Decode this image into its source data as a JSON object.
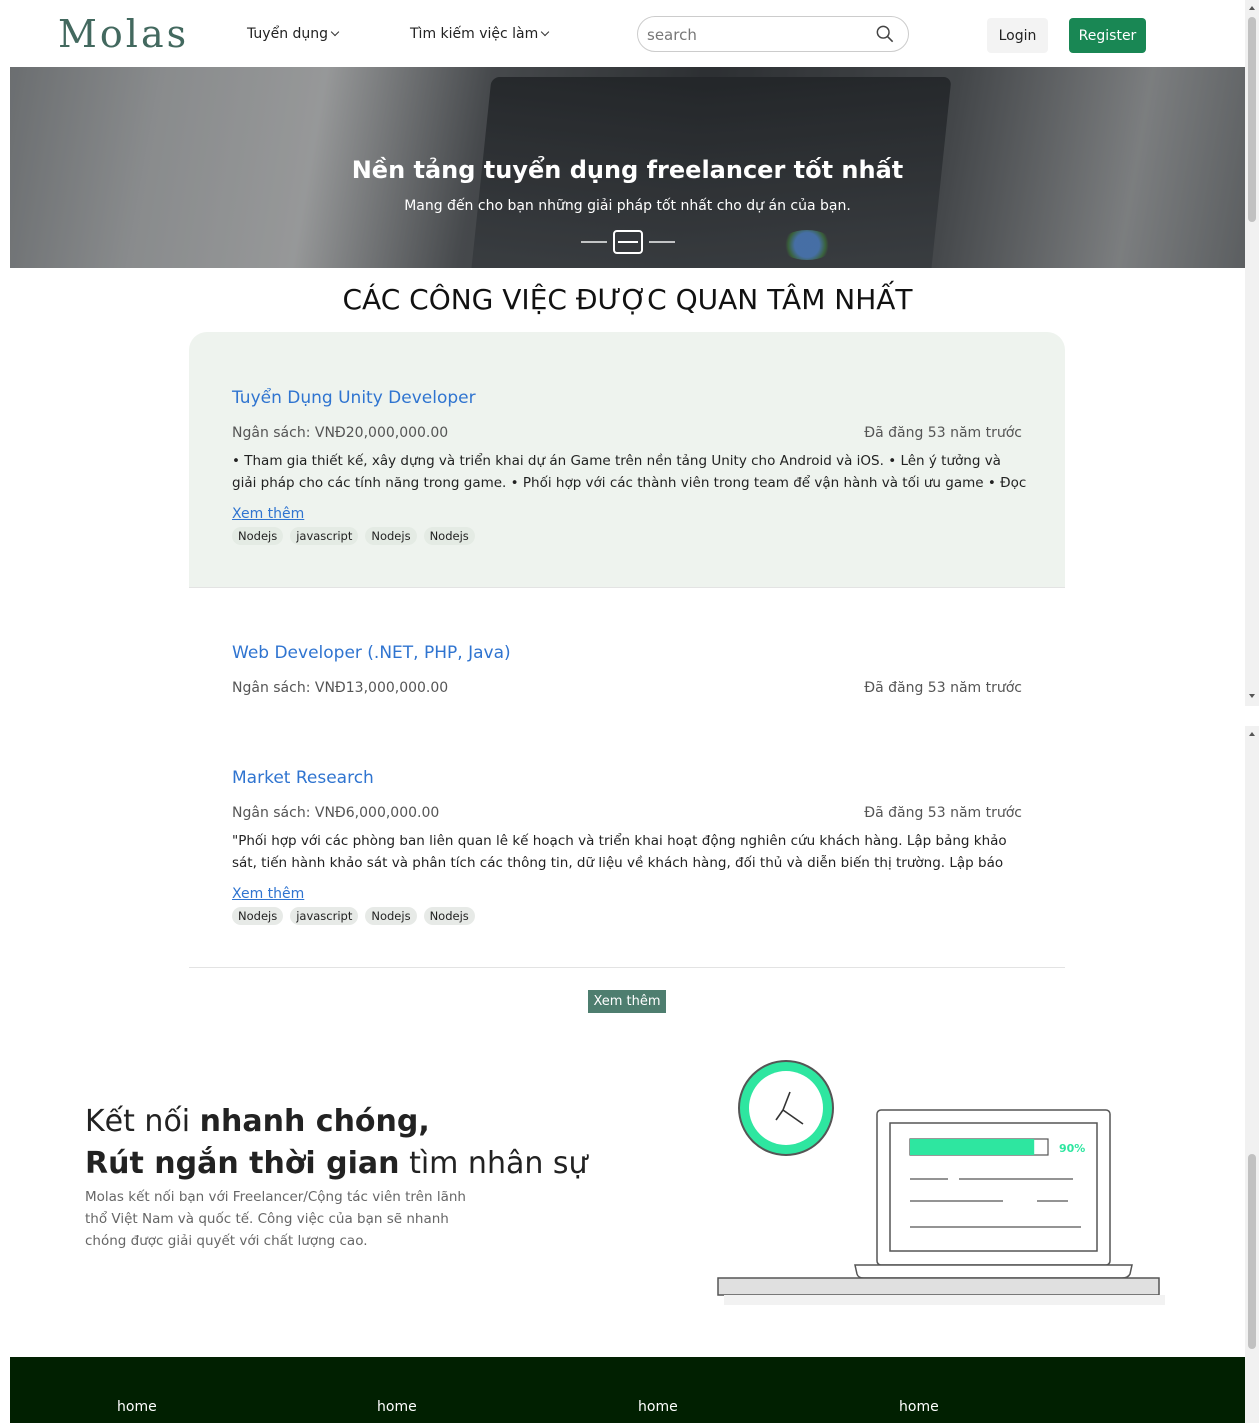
{
  "nav": {
    "logo": "Molas",
    "menu": [
      "Tuyển dụng",
      "Tìm kiếm việc làm"
    ],
    "search_placeholder": "search",
    "login": "Login",
    "register": "Register"
  },
  "hero": {
    "title": "Nền tảng tuyển dụng freelancer tốt nhất",
    "subtitle": "Mang đến cho bạn những giải pháp tốt nhất cho dự án của bạn.",
    "slide_count": 3,
    "active_slide": 2
  },
  "section": {
    "title": "CÁC CÔNG VIỆC ĐƯỢC QUAN TÂM NHẤT"
  },
  "jobs": [
    {
      "title": "Tuyển Dụng Unity Developer",
      "budget": "Ngân sách: VNĐ20,000,000.00",
      "posted": "Đã đăng 53 năm trước",
      "description": "• Tham gia thiết kế, xây dựng và triển khai dự án Game trên nền tảng Unity cho Android và iOS. • Lên ý tưởng và giải pháp cho các tính năng trong game. • Phối hợp với các thành viên trong team để vận hành và tối ưu game • Đọc hiểu source...",
      "more": "Xem thêm",
      "tags": [
        "Nodejs",
        "javascript",
        "Nodejs",
        "Nodejs"
      ]
    },
    {
      "title": "Web Developer (.NET, PHP, Java)",
      "budget": "Ngân sách: VNĐ13,000,000.00",
      "posted": "Đã đăng 53 năm trước"
    },
    {
      "title": "Market Research",
      "budget": "Ngân sách: VNĐ6,000,000.00",
      "posted": "Đã đăng 53 năm trước",
      "description": "\"Phối hợp với các phòng ban liên quan lê kế hoạch và triển khai hoạt động nghiên cứu khách hàng. Lập bảng khảo sát, tiến hành khảo sát và phân tích các thông tin, dữ liệu về khách hàng, đối thủ và diễn biến thị trường. Lập báo cáo về đin...",
      "more": "Xem thêm",
      "tags": [
        "Nodejs",
        "javascript",
        "Nodejs",
        "Nodejs"
      ]
    }
  ],
  "more_button": "Xem thêm",
  "promo": {
    "line1_normal": "Kết nối ",
    "line1_bold": "nhanh chóng,",
    "line2_bold": "Rút ngắn thời gian",
    "line2_normal": " tìm nhân sự",
    "paragraph": "Molas kết nối bạn với Freelancer/Cộng tác viên trên lãnh thổ Việt Nam và quốc tế. Công việc của bạn sẽ nhanh chóng được giải quyết với chất lượng cao.",
    "progress_label": "90%",
    "progress_value": 0.9
  },
  "footer": {
    "links": [
      "home",
      "home",
      "home",
      "home"
    ]
  },
  "colors": {
    "brand": "#43695f",
    "register": "#198754",
    "link": "#2f74d0",
    "footer": "#012001",
    "accent_green": "#2ee6a0"
  }
}
